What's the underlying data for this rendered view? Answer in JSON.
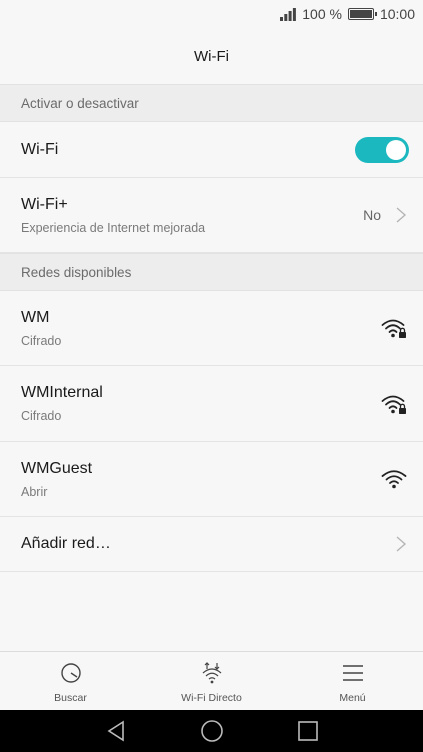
{
  "status": {
    "battery_text": "100 %",
    "time": "10:00",
    "icons": [
      "signal-icon",
      "battery-icon"
    ]
  },
  "title": "Wi-Fi",
  "sections": {
    "toggle_header": "Activar o desactivar",
    "networks_header": "Redes disponibles"
  },
  "wifi_row": {
    "label": "Wi-Fi",
    "enabled": true,
    "accent": "#1bb8bf"
  },
  "wifiplus_row": {
    "label": "Wi-Fi+",
    "subtitle": "Experiencia de Internet mejorada",
    "value": "No"
  },
  "networks": [
    {
      "name": "WM",
      "security": "Cifrado",
      "icon": "wifi-locked-icon"
    },
    {
      "name": "WMInternal",
      "security": "Cifrado",
      "icon": "wifi-locked-icon"
    },
    {
      "name": "WMGuest",
      "security": "Abrir",
      "icon": "wifi-icon"
    }
  ],
  "add_network": "Añadir red…",
  "bottom_bar": {
    "search": "Buscar",
    "direct": "Wi-Fi Directo",
    "menu": "Menú"
  }
}
